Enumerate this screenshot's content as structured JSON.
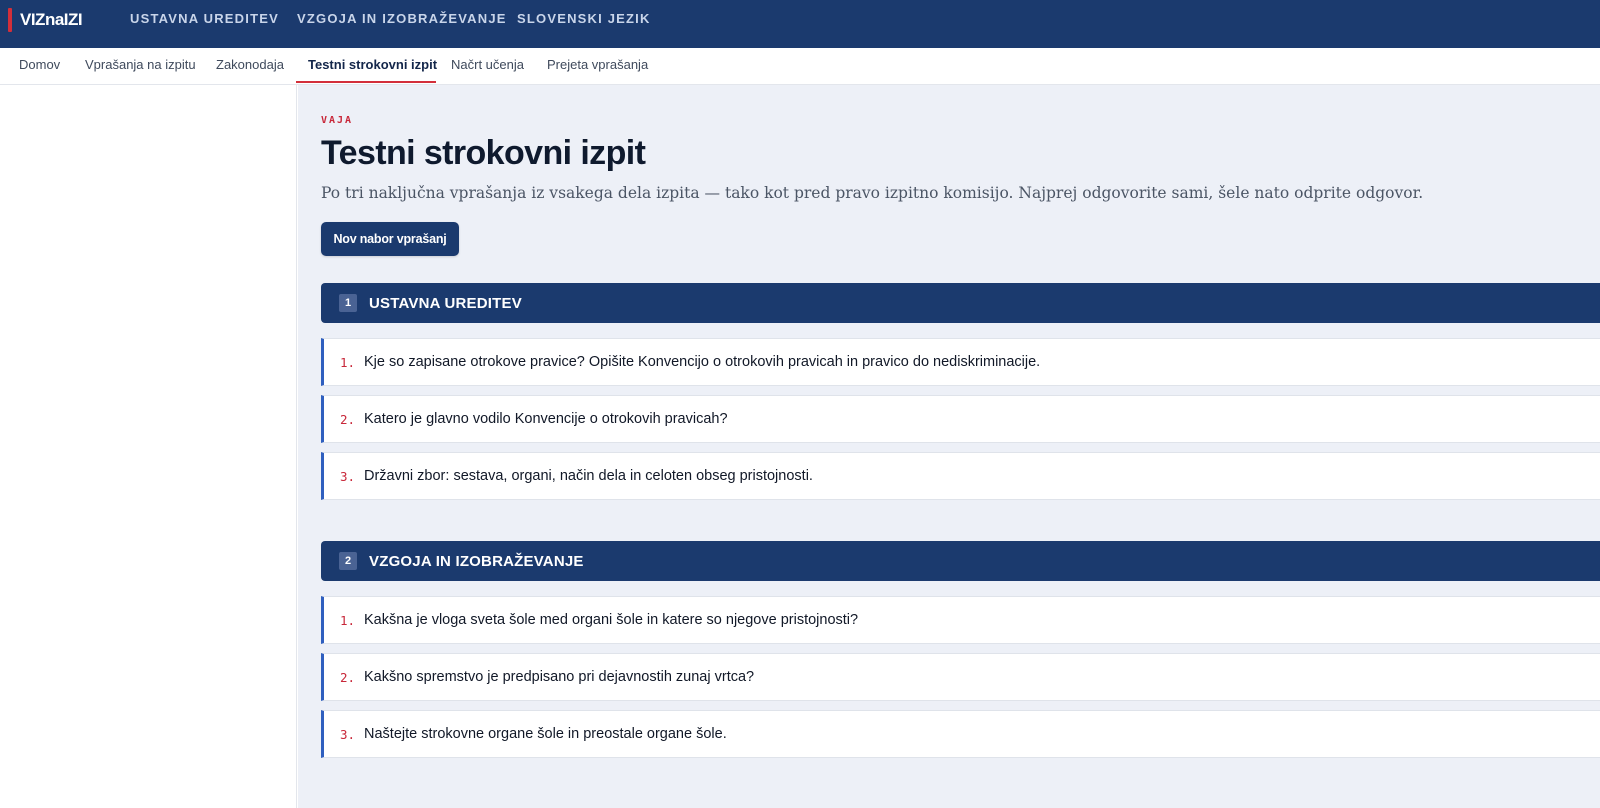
{
  "brand": {
    "name": "VIZnaIZI",
    "accent_color": "#d32f3a"
  },
  "topnav": [
    {
      "label": "USTAVNA UREDITEV"
    },
    {
      "label": "VZGOJA IN IZOBRAŽEVANJE"
    },
    {
      "label": "SLOVENSKI JEZIK"
    }
  ],
  "subnav": [
    {
      "label": "Domov"
    },
    {
      "label": "Vprašanja na izpitu"
    },
    {
      "label": "Zakonodaja"
    },
    {
      "label": "Testni strokovni izpit",
      "active": true
    },
    {
      "label": "Načrt učenja"
    },
    {
      "label": "Prejeta vprašanja"
    }
  ],
  "page": {
    "eyebrow": "VAJA",
    "title": "Testni strokovni izpit",
    "lead": "Po tri naključna vprašanja iz vsakega dela izpita — tako kot pred pravo izpitno komisijo. Najprej odgovorite sami, šele nato odprite odgovor.",
    "new_set_label": "Nov nabor vprašanj"
  },
  "sections": [
    {
      "number": "1",
      "title": "USTAVNA UREDITEV",
      "questions": [
        {
          "num": "1.",
          "text": "Kje so zapisane otrokove pravice? Opišite Konvencijo o otrokovih pravicah in pravico do nediskriminacije."
        },
        {
          "num": "2.",
          "text": "Katero je glavno vodilo Konvencije o otrokovih pravicah?"
        },
        {
          "num": "3.",
          "text": "Državni zbor: sestava, organi, način dela in celoten obseg pristojnosti."
        }
      ]
    },
    {
      "number": "2",
      "title": "VZGOJA IN IZOBRAŽEVANJE",
      "questions": [
        {
          "num": "1.",
          "text": "Kakšna je vloga sveta šole med organi šole in katere so njegove pristojnosti?"
        },
        {
          "num": "2.",
          "text": "Kakšno spremstvo je predpisano pri dejavnostih zunaj vrtca?"
        },
        {
          "num": "3.",
          "text": "Naštejte strokovne organe šole in preostale organe šole."
        }
      ]
    }
  ],
  "colors": {
    "navy": "#1b3a6e",
    "accent_red": "#c8283a",
    "question_border": "#2f5fbf",
    "main_bg": "#edf0f7"
  }
}
